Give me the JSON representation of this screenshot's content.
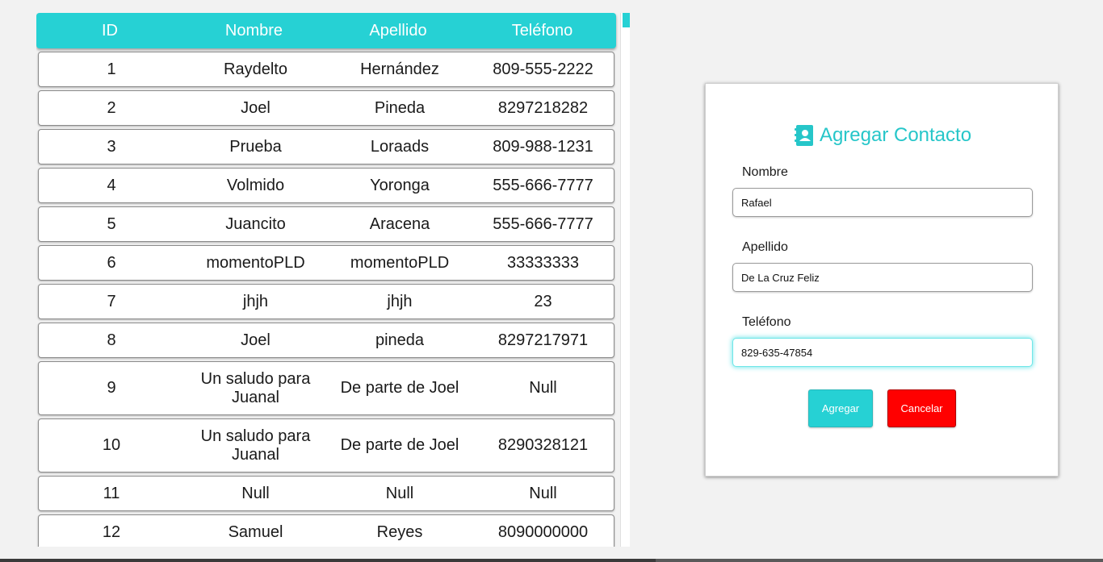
{
  "table": {
    "headers": {
      "id": "ID",
      "nombre": "Nombre",
      "apellido": "Apellido",
      "telefono": "Teléfono"
    },
    "rows": [
      {
        "id": "1",
        "nombre": "Raydelto",
        "apellido": "Hernández",
        "telefono": "809-555-2222"
      },
      {
        "id": "2",
        "nombre": "Joel",
        "apellido": "Pineda",
        "telefono": "8297218282"
      },
      {
        "id": "3",
        "nombre": "Prueba",
        "apellido": "Loraads",
        "telefono": "809-988-1231"
      },
      {
        "id": "4",
        "nombre": "Volmido",
        "apellido": "Yoronga",
        "telefono": "555-666-7777"
      },
      {
        "id": "5",
        "nombre": "Juancito",
        "apellido": "Aracena",
        "telefono": "555-666-7777"
      },
      {
        "id": "6",
        "nombre": "momentoPLD",
        "apellido": "momentoPLD",
        "telefono": "33333333"
      },
      {
        "id": "7",
        "nombre": "jhjh",
        "apellido": "jhjh",
        "telefono": "23"
      },
      {
        "id": "8",
        "nombre": "Joel",
        "apellido": "pineda",
        "telefono": "8297217971"
      },
      {
        "id": "9",
        "nombre_line1": "Un saludo para",
        "nombre_line2": "Juanal",
        "apellido": "De parte de Joel",
        "telefono": "Null"
      },
      {
        "id": "10",
        "nombre_line1": "Un saludo para",
        "nombre_line2": "Juanal",
        "apellido": "De parte de Joel",
        "telefono": "8290328121"
      },
      {
        "id": "11",
        "nombre": "Null",
        "apellido": "Null",
        "telefono": "Null"
      },
      {
        "id": "12",
        "nombre": "Samuel",
        "apellido": "Reyes",
        "telefono": "8090000000"
      }
    ]
  },
  "form": {
    "title": "Agregar Contacto",
    "title_icon": "address-book-icon",
    "nombre_label": "Nombre",
    "nombre_value": "Rafael",
    "apellido_label": "Apellido",
    "apellido_value": "De La Cruz Feliz",
    "telefono_label": "Teléfono",
    "telefono_value": "829-635-47854",
    "add_button": "Agregar",
    "cancel_button": "Cancelar"
  },
  "colors": {
    "accent": "#26d1d4",
    "danger": "#ff0000",
    "background": "#f2f2f2"
  }
}
